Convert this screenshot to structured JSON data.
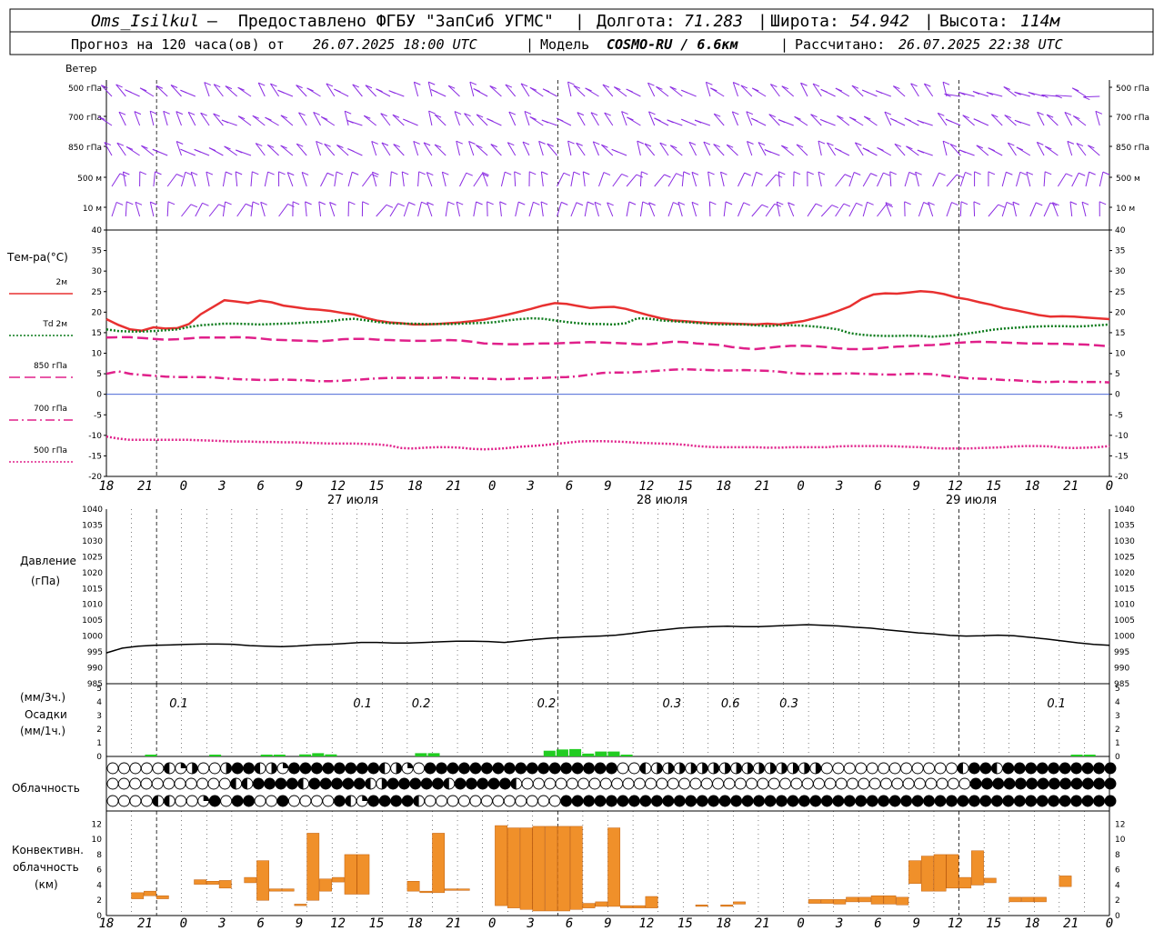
{
  "header": {
    "station": "Oms_Isilkul",
    "provider": "Предоставлено ФГБУ \"ЗапСиб УГМС\"",
    "lon_label": "Долгота:",
    "lon": "71.283",
    "lat_label": "Широта:",
    "lat": "54.942",
    "alt_label": "Высота:",
    "alt": "114м",
    "forecast_prefix": "Прогноз на 120 часа(ов) от",
    "forecast_time": "26.07.2025 18:00 UTC",
    "model_label": "Модель",
    "model": "COSMO-RU / 6.6км",
    "calc_label": "Рассчитано:",
    "calc_time": "26.07.2025 22:38 UTC"
  },
  "panels": {
    "wind": {
      "title": "Ветер",
      "levels": [
        "500 гПа",
        "700 гПа",
        "850 гПа",
        "500 м",
        "10 м"
      ]
    },
    "temperature": {
      "title": "Тем-ра(°C)",
      "legend": [
        {
          "label": "2м",
          "color": "#e83030",
          "style": "solid"
        },
        {
          "label": "Td 2м",
          "color": "#0a7a1a",
          "style": "dotted"
        },
        {
          "label": "850 гПа",
          "color": "#e0208a",
          "style": "dashed"
        },
        {
          "label": "700 гПа",
          "color": "#e0208a",
          "style": "dashdot"
        },
        {
          "label": "500 гПа",
          "color": "#e0208a",
          "style": "dotted"
        }
      ]
    },
    "pressure": {
      "title": "Давление",
      "unit": "(гПа)"
    },
    "precip": {
      "title_1": "(мм/3ч.)",
      "title_2": "Осадки",
      "title_3": "(мм/1ч.)"
    },
    "cloud": {
      "title": "Облачность"
    },
    "convective": {
      "title_1": "Конвективн.",
      "title_2": "облачность",
      "title_3": "(км)"
    }
  },
  "dates": [
    "27 июля",
    "28 июля",
    "29 июля"
  ],
  "hour_ticks": [
    "18",
    "21",
    "0",
    "3",
    "6",
    "9",
    "12",
    "15",
    "18",
    "21",
    "0",
    "3",
    "6",
    "9",
    "12",
    "15",
    "18",
    "21",
    "0",
    "3",
    "6",
    "9",
    "12",
    "15",
    "18",
    "21",
    "0"
  ],
  "chart_data": [
    {
      "type": "line",
      "title": "Тем-ра(°C)",
      "ylim": [
        -20,
        40
      ],
      "yticks": [
        "40",
        "35",
        "30",
        "25",
        "20",
        "15",
        "10",
        "5",
        "0",
        "-5",
        "-10",
        "-15",
        "-20"
      ],
      "series": [
        {
          "name": "2м",
          "color": "#e83030",
          "values": [
            18.3,
            16.9,
            15.8,
            15.5,
            16.3,
            16.0,
            16.1,
            17.1,
            19.5,
            21.2,
            22.9,
            22.6,
            22.2,
            22.8,
            22.4,
            21.6,
            21.2,
            20.8,
            20.6,
            20.3,
            19.8,
            19.4,
            18.6,
            17.9,
            17.5,
            17.3,
            17.0,
            17.0,
            17.1,
            17.3,
            17.5,
            17.8,
            18.2,
            18.8,
            19.4,
            20.1,
            20.8,
            21.6,
            22.2,
            22.0,
            21.5,
            21.0,
            21.2,
            21.3,
            20.8,
            20.0,
            19.2,
            18.5,
            18.0,
            17.8,
            17.6,
            17.4,
            17.3,
            17.2,
            17.1,
            17.0,
            17.2,
            17.0,
            17.4,
            17.8,
            18.5,
            19.3,
            20.3,
            21.4,
            23.2,
            24.3,
            24.6,
            24.5,
            24.8,
            25.1,
            24.9,
            24.4,
            23.6,
            23.1,
            22.4,
            21.8,
            21.0,
            20.5,
            19.9,
            19.3,
            18.9,
            19.0,
            18.9,
            18.7,
            18.5,
            18.3
          ]
        },
        {
          "name": "Td 2м",
          "color": "#0a7a1a",
          "values": [
            15.8,
            15.4,
            15.3,
            15.3,
            15.4,
            15.6,
            15.8,
            16.4,
            16.8,
            17.0,
            17.2,
            17.2,
            17.1,
            17.0,
            17.1,
            17.2,
            17.3,
            17.5,
            17.6,
            17.8,
            18.2,
            18.4,
            18.0,
            17.6,
            17.3,
            17.2,
            17.2,
            17.1,
            17.1,
            17.1,
            17.2,
            17.3,
            17.4,
            17.6,
            18.0,
            18.3,
            18.5,
            18.4,
            18.0,
            17.6,
            17.3,
            17.1,
            17.1,
            17.0,
            17.3,
            18.5,
            18.4,
            18.0,
            17.8,
            17.6,
            17.4,
            17.2,
            17.0,
            17.0,
            17.0,
            16.8,
            16.6,
            16.8,
            16.8,
            16.7,
            16.5,
            16.2,
            15.8,
            14.9,
            14.5,
            14.3,
            14.2,
            14.2,
            14.3,
            14.2,
            14.0,
            14.2,
            14.4,
            14.8,
            15.2,
            15.7,
            16.0,
            16.2,
            16.4,
            16.5,
            16.6,
            16.6,
            16.5,
            16.6,
            16.8,
            17.0
          ]
        },
        {
          "name": "850 гПа",
          "color": "#e0208a",
          "values": [
            13.8,
            13.9,
            13.9,
            13.7,
            13.5,
            13.3,
            13.4,
            13.6,
            13.8,
            13.8,
            13.8,
            13.9,
            13.8,
            13.6,
            13.3,
            13.2,
            13.1,
            13.0,
            12.9,
            13.1,
            13.4,
            13.5,
            13.5,
            13.3,
            13.2,
            13.1,
            13.0,
            13.0,
            13.1,
            13.2,
            13.1,
            12.8,
            12.4,
            12.3,
            12.2,
            12.2,
            12.3,
            12.4,
            12.4,
            12.5,
            12.6,
            12.7,
            12.6,
            12.5,
            12.4,
            12.2,
            12.2,
            12.5,
            12.8,
            12.7,
            12.4,
            12.2,
            12.0,
            11.5,
            11.2,
            11.0,
            11.3,
            11.6,
            11.8,
            11.8,
            11.7,
            11.5,
            11.2,
            11.0,
            11.0,
            11.1,
            11.4,
            11.6,
            11.7,
            11.9,
            12.0,
            12.2,
            12.5,
            12.7,
            12.8,
            12.7,
            12.6,
            12.5,
            12.4,
            12.4,
            12.3,
            12.3,
            12.2,
            12.1,
            11.9,
            11.7
          ]
        },
        {
          "name": "700 гПа",
          "color": "#e0208a",
          "values": [
            5.0,
            5.6,
            5.0,
            4.7,
            4.5,
            4.3,
            4.2,
            4.2,
            4.2,
            4.1,
            3.9,
            3.7,
            3.6,
            3.5,
            3.5,
            3.6,
            3.5,
            3.4,
            3.2,
            3.2,
            3.3,
            3.5,
            3.7,
            3.9,
            4.0,
            4.0,
            4.0,
            4.0,
            4.0,
            4.1,
            4.0,
            3.9,
            3.8,
            3.7,
            3.7,
            3.8,
            3.9,
            4.0,
            4.1,
            4.2,
            4.4,
            4.8,
            5.2,
            5.3,
            5.3,
            5.4,
            5.6,
            5.8,
            6.0,
            6.1,
            6.0,
            5.9,
            5.8,
            5.8,
            5.9,
            5.8,
            5.7,
            5.5,
            5.2,
            5.0,
            5.0,
            5.0,
            5.0,
            5.1,
            5.0,
            4.9,
            4.8,
            4.8,
            5.0,
            5.0,
            4.9,
            4.5,
            4.2,
            3.9,
            3.8,
            3.7,
            3.5,
            3.4,
            3.2,
            3.0,
            3.0,
            3.1,
            3.0,
            3.0,
            3.0,
            2.9
          ]
        },
        {
          "name": "500 гПа",
          "color": "#e0208a",
          "values": [
            -10.3,
            -10.8,
            -11.1,
            -11.1,
            -11.1,
            -11.1,
            -11.1,
            -11.1,
            -11.2,
            -11.3,
            -11.4,
            -11.5,
            -11.5,
            -11.6,
            -11.6,
            -11.7,
            -11.7,
            -11.8,
            -11.9,
            -12.0,
            -12.0,
            -12.0,
            -12.1,
            -12.2,
            -12.5,
            -13.1,
            -13.2,
            -13.0,
            -12.9,
            -12.9,
            -13.0,
            -13.3,
            -13.4,
            -13.3,
            -13.1,
            -12.8,
            -12.6,
            -12.4,
            -12.1,
            -11.8,
            -11.5,
            -11.4,
            -11.4,
            -11.5,
            -11.6,
            -11.8,
            -11.9,
            -12.0,
            -12.1,
            -12.3,
            -12.6,
            -12.8,
            -12.9,
            -12.9,
            -12.9,
            -12.9,
            -13.0,
            -13.0,
            -12.9,
            -12.9,
            -12.9,
            -12.9,
            -12.7,
            -12.6,
            -12.6,
            -12.6,
            -12.6,
            -12.7,
            -12.8,
            -12.9,
            -13.1,
            -13.2,
            -13.2,
            -13.2,
            -13.1,
            -13.0,
            -12.9,
            -12.7,
            -12.6,
            -12.6,
            -12.7,
            -13.0,
            -13.1,
            -13.0,
            -12.9,
            -12.6
          ]
        }
      ]
    },
    {
      "type": "line",
      "title": "Давление",
      "ylabel": "(гПа)",
      "ylim": [
        985,
        1040
      ],
      "yticks": [
        "1040",
        "1035",
        "1030",
        "1025",
        "1020",
        "1015",
        "1010",
        "1005",
        "1000",
        "995",
        "990",
        "985"
      ],
      "series": [
        {
          "name": "",
          "color": "#000000",
          "values": [
            994.7,
            996.2,
            996.8,
            997.1,
            997.2,
            997.4,
            997.5,
            997.5,
            997.4,
            997.0,
            996.8,
            996.7,
            996.9,
            997.2,
            997.4,
            997.7,
            998.0,
            998.0,
            997.8,
            997.8,
            998.0,
            998.2,
            998.4,
            998.4,
            998.3,
            998.0,
            998.5,
            999.0,
            999.4,
            999.6,
            999.8,
            1000.0,
            1000.3,
            1000.8,
            1001.5,
            1002.0,
            1002.5,
            1002.8,
            1003.0,
            1003.1,
            1003.0,
            1003.0,
            1003.2,
            1003.4,
            1003.6,
            1003.4,
            1003.2,
            1002.8,
            1002.5,
            1002.0,
            1001.5,
            1001.0,
            1000.7,
            1000.2,
            1000.0,
            1000.1,
            1000.3,
            1000.1,
            999.6,
            999.1,
            998.5,
            997.9,
            997.4,
            997.1
          ]
        }
      ]
    },
    {
      "type": "bar",
      "title": "Осадки",
      "ylim": [
        0,
        5
      ],
      "labels": [
        "0.1",
        "0.1",
        "0.2",
        "0.2",
        "0.3",
        "0.6",
        "0.3",
        "0.1"
      ],
      "values_mm_3h": [
        0.1,
        0.1,
        0.2,
        0.2,
        0.3,
        0.6,
        0.3,
        0.1
      ]
    },
    {
      "type": "bar",
      "title": "Конвективн. облачность",
      "ylim": [
        0,
        13
      ],
      "yticks": [
        "0",
        "2",
        "4",
        "6",
        "8",
        "10",
        "12"
      ],
      "bars_km": [
        [
          2,
          2.2,
          3
        ],
        [
          3,
          2.6,
          3.2
        ],
        [
          4,
          2.2,
          2.6
        ],
        [
          7,
          4.1,
          4.7
        ],
        [
          8,
          4.1,
          4.5
        ],
        [
          9,
          3.6,
          4.6
        ],
        [
          11,
          4.3,
          5.0
        ],
        [
          12,
          2.0,
          7.2
        ],
        [
          13,
          3.2,
          3.5
        ],
        [
          14,
          3.2,
          3.5
        ],
        [
          15,
          1.3,
          1.5
        ],
        [
          16,
          2.0,
          10.8
        ],
        [
          17,
          3.2,
          4.8
        ],
        [
          18,
          4.4,
          5.0
        ],
        [
          19,
          2.8,
          8.0
        ],
        [
          20,
          2.8,
          8.0
        ],
        [
          24,
          3.2,
          4.5
        ],
        [
          25,
          3.0,
          3.2
        ],
        [
          26,
          3.0,
          10.8
        ],
        [
          27,
          3.3,
          3.5
        ],
        [
          28,
          3.3,
          3.5
        ],
        [
          31,
          1.3,
          11.8
        ],
        [
          32,
          1.0,
          11.5
        ],
        [
          33,
          0.8,
          11.5
        ],
        [
          34,
          0.6,
          11.7
        ],
        [
          35,
          0.6,
          11.7
        ],
        [
          36,
          0.6,
          11.7
        ],
        [
          37,
          0.8,
          11.7
        ],
        [
          38,
          1.0,
          1.6
        ],
        [
          39,
          1.2,
          1.8
        ],
        [
          40,
          1.2,
          11.5
        ],
        [
          41,
          1.0,
          1.3
        ],
        [
          42,
          1.0,
          1.3
        ],
        [
          43,
          1.0,
          2.5
        ],
        [
          47,
          1.2,
          1.4
        ],
        [
          49,
          1.2,
          1.4
        ],
        [
          50,
          1.5,
          1.8
        ],
        [
          56,
          1.6,
          2.1
        ],
        [
          57,
          1.6,
          2.1
        ],
        [
          58,
          1.5,
          2.1
        ],
        [
          59,
          1.8,
          2.4
        ],
        [
          60,
          1.8,
          2.4
        ],
        [
          61,
          1.5,
          2.6
        ],
        [
          62,
          1.5,
          2.6
        ],
        [
          63,
          1.4,
          2.4
        ],
        [
          64,
          4.2,
          7.2
        ],
        [
          65,
          3.2,
          7.8
        ],
        [
          66,
          3.2,
          8.0
        ],
        [
          67,
          3.6,
          8.0
        ],
        [
          68,
          3.6,
          5.0
        ],
        [
          69,
          4.0,
          8.5
        ],
        [
          70,
          4.3,
          4.9
        ],
        [
          72,
          1.8,
          2.4
        ],
        [
          73,
          1.8,
          2.4
        ],
        [
          74,
          1.8,
          2.4
        ],
        [
          76,
          3.8,
          5.2
        ]
      ]
    }
  ],
  "cloud_rows": [
    "OOOOOLRHOOHFFLHRFFFFFFFFLHROFFFFFFFFFFFFFFFFFOOLHHHHHHHHHHHHHHHOOOOOOOOOOOOLFFLFFFFFFFFFF",
    "OOOOOOOOOOOLLFFFFLFFFFFLHFFFFFLFFFFFLOOOOOOOOOOOOOOOOOOOOOOOOOOOOOOOOOOOOOOOOFFFFFFFFFFFFF",
    "OOOOLLOORFOFFOOFOOOOFLRFFFFLOOOOOOOOOOOOFFFFFFFFFFFFFFFFFFFFFFFFFFFFFFFFFFFFFFFFFFFFFFFFF"
  ],
  "precip_bars": [
    [
      3,
      0.04
    ],
    [
      8,
      0.03
    ],
    [
      12,
      0.04
    ],
    [
      13,
      0.03
    ],
    [
      15,
      0.05
    ],
    [
      16,
      0.08
    ],
    [
      17,
      0.05
    ],
    [
      24,
      0.08
    ],
    [
      25,
      0.08
    ],
    [
      34,
      0.14
    ],
    [
      35,
      0.17
    ],
    [
      36,
      0.18
    ],
    [
      37,
      0.07
    ],
    [
      38,
      0.12
    ],
    [
      39,
      0.12
    ],
    [
      40,
      0.04
    ],
    [
      75,
      0.03
    ],
    [
      76,
      0.03
    ]
  ],
  "wind_color": "#8a2be2"
}
